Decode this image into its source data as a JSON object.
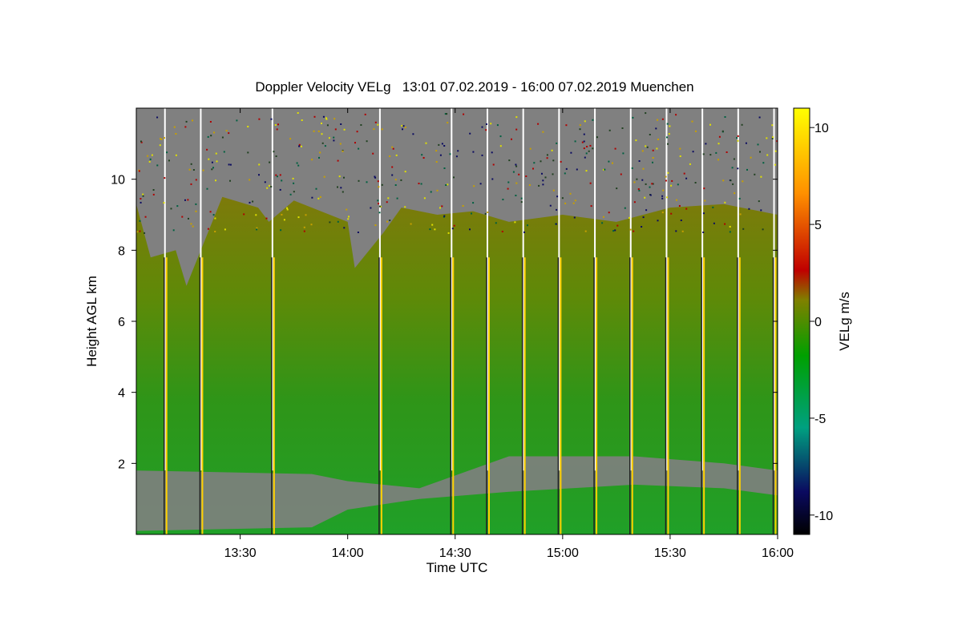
{
  "chart_data": {
    "type": "heatmap",
    "title": "Doppler Velocity VELg   13:01 07.02.2019 - 16:00 07.02.2019 Muenchen",
    "xlabel": "Time UTC",
    "ylabel": "Height AGL km",
    "colorbar_label": "VELg m/s",
    "x_range": [
      "13:01",
      "16:00"
    ],
    "x_ticks": [
      "13:30",
      "14:00",
      "14:30",
      "15:00",
      "15:30",
      "16:00"
    ],
    "y_range": [
      0,
      12
    ],
    "y_ticks": [
      "2",
      "4",
      "6",
      "8",
      "10"
    ],
    "colorbar_range": [
      -11,
      11
    ],
    "colorbar_ticks": [
      "10",
      "5",
      "0",
      "-5",
      "-10"
    ],
    "missing_color": "#808080",
    "colormap": [
      "#000000",
      "#0a0a60",
      "#00a080",
      "#00a000",
      "#808000",
      "#c00000",
      "#ff9000",
      "#ffff00"
    ],
    "cloud_top_km": [
      {
        "t": "13:01",
        "h": 9.3
      },
      {
        "t": "13:05",
        "h": 7.8
      },
      {
        "t": "13:12",
        "h": 8.0
      },
      {
        "t": "13:15",
        "h": 7.0
      },
      {
        "t": "13:25",
        "h": 9.5
      },
      {
        "t": "13:35",
        "h": 9.2
      },
      {
        "t": "13:38",
        "h": 8.8
      },
      {
        "t": "13:45",
        "h": 9.4
      },
      {
        "t": "14:00",
        "h": 8.8
      },
      {
        "t": "14:02",
        "h": 7.5
      },
      {
        "t": "14:10",
        "h": 8.5
      },
      {
        "t": "14:15",
        "h": 9.2
      },
      {
        "t": "14:25",
        "h": 9.0
      },
      {
        "t": "14:35",
        "h": 9.1
      },
      {
        "t": "14:45",
        "h": 8.8
      },
      {
        "t": "15:00",
        "h": 9.0
      },
      {
        "t": "15:15",
        "h": 8.8
      },
      {
        "t": "15:30",
        "h": 9.2
      },
      {
        "t": "15:45",
        "h": 9.3
      },
      {
        "t": "16:00",
        "h": 9.0
      }
    ],
    "scan_times": [
      "13:09",
      "13:19",
      "13:39",
      "14:09",
      "14:29",
      "14:39",
      "14:49",
      "14:59",
      "15:09",
      "15:19",
      "15:29",
      "15:39",
      "15:49",
      "15:59"
    ],
    "low_gray_layer_km": [
      {
        "t": "13:01",
        "bottom": 0.1,
        "top": 1.8
      },
      {
        "t": "13:50",
        "bottom": 0.2,
        "top": 1.7
      },
      {
        "t": "14:00",
        "bottom": 0.7,
        "top": 1.5
      },
      {
        "t": "14:20",
        "bottom": 1.0,
        "top": 1.3
      },
      {
        "t": "14:45",
        "bottom": 1.2,
        "top": 2.2
      },
      {
        "t": "15:20",
        "bottom": 1.4,
        "top": 2.2
      },
      {
        "t": "15:45",
        "bottom": 1.3,
        "top": 2.0
      },
      {
        "t": "16:00",
        "bottom": 1.1,
        "top": 1.8
      }
    ]
  }
}
